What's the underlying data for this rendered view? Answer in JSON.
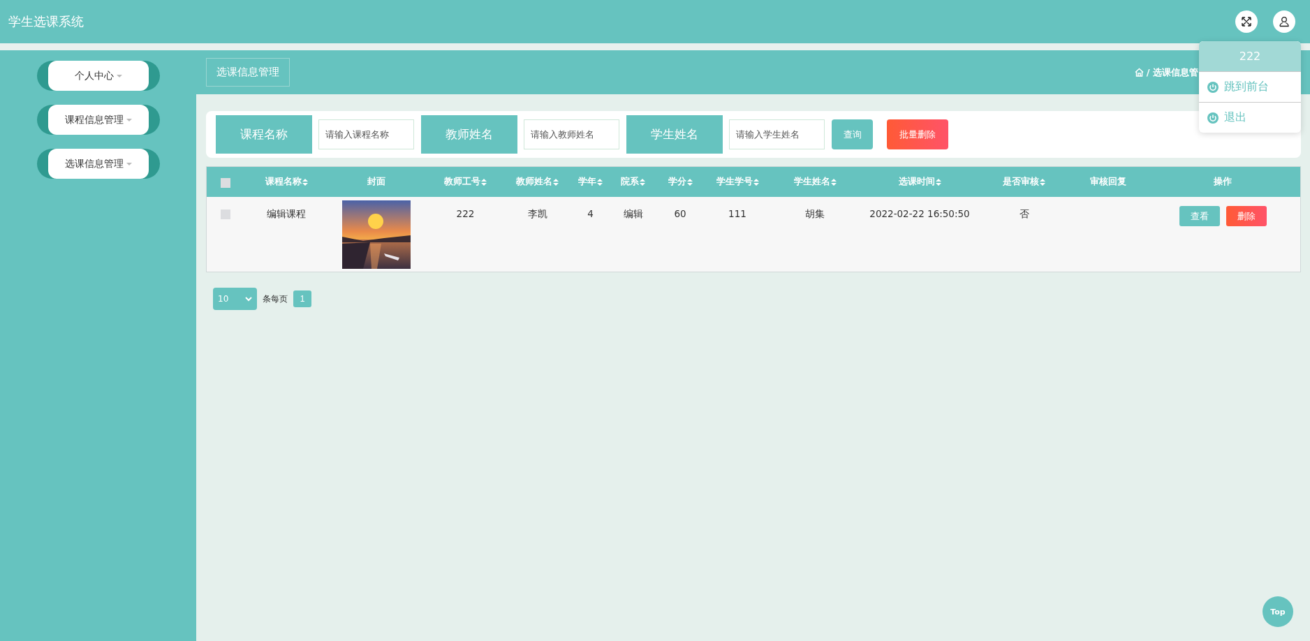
{
  "app": {
    "title": "学生选课系统"
  },
  "sidebar": {
    "items": [
      {
        "label": "个人中心"
      },
      {
        "label": "课程信息管理"
      },
      {
        "label": "选课信息管理"
      }
    ]
  },
  "page_header": {
    "title": "选课信息管理",
    "breadcrumb": "/ 选课信息管"
  },
  "search": {
    "fields": [
      {
        "label": "课程名称",
        "placeholder": "请输入课程名称"
      },
      {
        "label": "教师姓名",
        "placeholder": "请输入教师姓名"
      },
      {
        "label": "学生姓名",
        "placeholder": "请输入学生姓名"
      }
    ],
    "buttons": [
      {
        "label": "查询",
        "kind": "search"
      },
      {
        "label": "批量删除",
        "kind": "delete"
      }
    ]
  },
  "table": {
    "columns": [
      {
        "kind": "checkbox",
        "checked": false
      },
      {
        "kind": "text",
        "label": "课程名称",
        "sortable": true
      },
      {
        "kind": "picture",
        "label": "封面",
        "sortable": false
      },
      {
        "kind": "text",
        "label": "教师工号",
        "sortable": true
      },
      {
        "kind": "text",
        "label": "教师姓名",
        "sortable": true
      },
      {
        "kind": "text",
        "label": "学年",
        "sortable": true
      },
      {
        "kind": "text",
        "label": "院系",
        "sortable": true
      },
      {
        "kind": "text",
        "label": "学分",
        "sortable": true
      },
      {
        "kind": "text",
        "label": "学生学号",
        "sortable": true
      },
      {
        "kind": "text",
        "label": "学生姓名",
        "sortable": true
      },
      {
        "kind": "text",
        "label": "选课时间",
        "sortable": true
      },
      {
        "kind": "text",
        "label": "是否审核",
        "sortable": true
      },
      {
        "kind": "text",
        "label": "审核回复",
        "sortable": false
      },
      {
        "kind": "actions",
        "label": "操作",
        "sortable": false
      }
    ],
    "rows": [
      {
        "cells": [
          {
            "kind": "checkbox",
            "checked": false
          },
          {
            "kind": "text",
            "text": "编辑课程"
          },
          {
            "kind": "picture"
          },
          {
            "kind": "text",
            "text": "222"
          },
          {
            "kind": "text",
            "text": "李凯"
          },
          {
            "kind": "text",
            "text": "4"
          },
          {
            "kind": "text",
            "text": "编辑"
          },
          {
            "kind": "text",
            "text": "60"
          },
          {
            "kind": "text",
            "text": "111"
          },
          {
            "kind": "text",
            "text": "胡集"
          },
          {
            "kind": "text",
            "text": "2022-02-22 16:50:50"
          },
          {
            "kind": "text",
            "text": "否"
          },
          {
            "kind": "empty"
          },
          {
            "kind": "actions",
            "buttons": [
              {
                "label": "查看",
                "kind": "view"
              },
              {
                "label": "删除",
                "kind": "delete"
              }
            ]
          }
        ]
      }
    ]
  },
  "pagination": {
    "page_size": "10",
    "page_size_label": "条每页",
    "pages": [
      {
        "label": "1",
        "selected": true
      }
    ]
  },
  "user_menu": {
    "username": "222",
    "items": [
      {
        "label": "跳到前台"
      },
      {
        "label": "退出"
      }
    ]
  },
  "top_button": {
    "label": "Top"
  }
}
